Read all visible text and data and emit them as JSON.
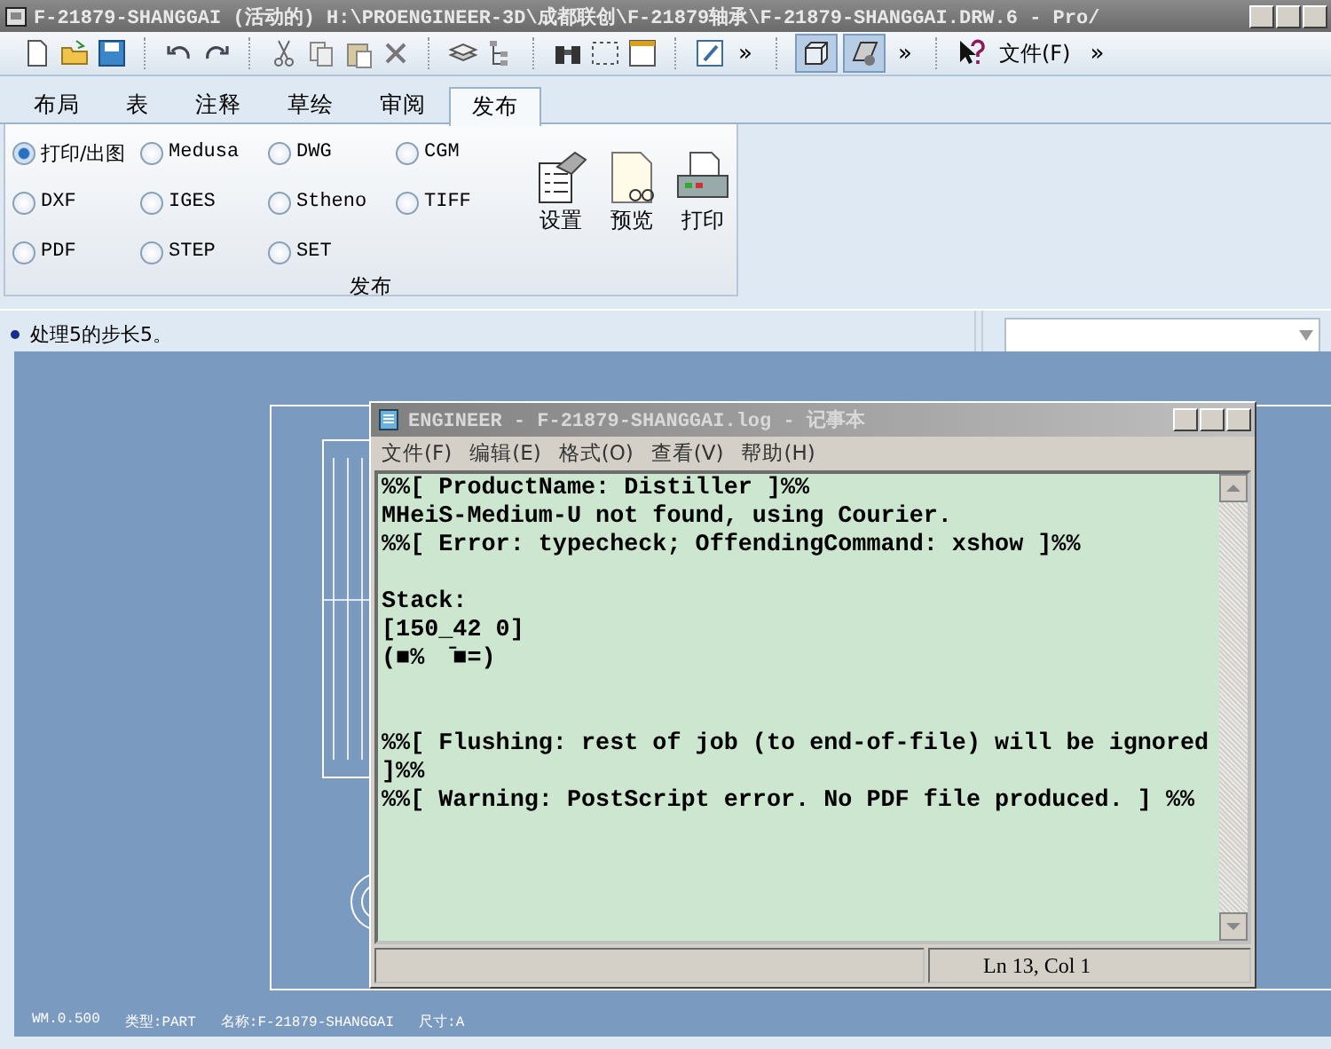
{
  "window": {
    "title": "F-21879-SHANGGAI (活动的) H:\\PROENGINEER-3D\\成都联创\\F-21879轴承\\F-21879-SHANGGAI.DRW.6 - Pro/"
  },
  "toolbar": {
    "overflow_marks": [
      "»",
      "»",
      "»"
    ],
    "file_menu": "文件(F)"
  },
  "tabs": [
    {
      "label": "布局",
      "selected": false
    },
    {
      "label": "表",
      "selected": false
    },
    {
      "label": "注释",
      "selected": false
    },
    {
      "label": "草绘",
      "selected": false
    },
    {
      "label": "审阅",
      "selected": false
    },
    {
      "label": "发布",
      "selected": true
    }
  ],
  "ribbon": {
    "formats": [
      {
        "label": "打印/出图",
        "selected": true
      },
      {
        "label": "Medusa",
        "selected": false
      },
      {
        "label": "DWG",
        "selected": false
      },
      {
        "label": "CGM",
        "selected": false
      },
      {
        "label": "DXF",
        "selected": false
      },
      {
        "label": "IGES",
        "selected": false
      },
      {
        "label": "Stheno",
        "selected": false
      },
      {
        "label": "TIFF",
        "selected": false
      },
      {
        "label": "PDF",
        "selected": false
      },
      {
        "label": "STEP",
        "selected": false
      },
      {
        "label": "SET",
        "selected": false
      }
    ],
    "buttons": [
      {
        "label": "设置",
        "kind": "settings"
      },
      {
        "label": "预览",
        "kind": "preview"
      },
      {
        "label": "打印",
        "kind": "print"
      }
    ],
    "group_label": "发布"
  },
  "message_bar": {
    "text": "处理5的步长5。"
  },
  "sheet_info": [
    "WM.0.500",
    "类型:PART",
    "名称:F-21879-SHANGGAI",
    "尺寸:A"
  ],
  "notepad": {
    "title": "ENGINEER - F-21879-SHANGGAI.log - 记事本",
    "menus": [
      "文件(F)",
      "编辑(E)",
      "格式(O)",
      "查看(V)",
      "帮助(H)"
    ],
    "lines": [
      {
        "text": "%%[ ProductName: Distiller ]%%"
      },
      {
        "text": "MHeiS-Medium-U not found, using Courier."
      },
      {
        "text": "%%[ Error: typecheck; OffendingCommand: xshow ]%%"
      },
      {
        "text": "Stack:",
        "kind": "paragraph"
      },
      {
        "text": "[150_42 0]"
      },
      {
        "text": "(■%  ̄■=)"
      },
      {
        "text": "%%[ Flushing: rest of job (to end-of-file) will be ignored",
        "kind": "section"
      },
      {
        "text": "]%%"
      },
      {
        "text": "%%[ Warning: PostScript error. No PDF file produced. ] %%"
      }
    ],
    "status": "Ln 13, Col 1"
  }
}
